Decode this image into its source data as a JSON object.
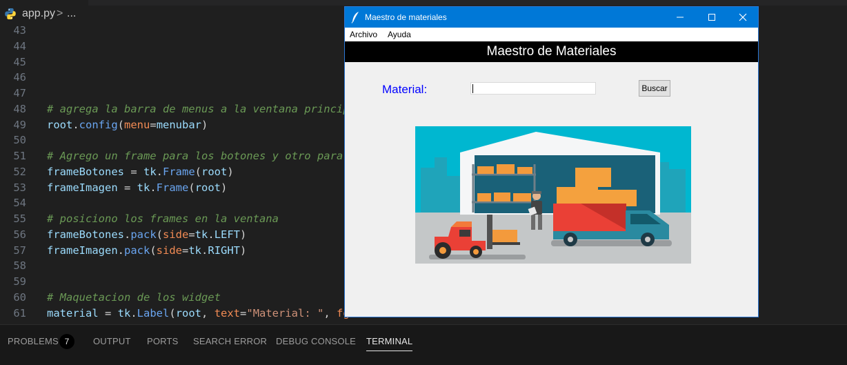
{
  "editor": {
    "breadcrumb": {
      "file": "app.py",
      "separator": ">",
      "more": "..."
    },
    "lines": [
      {
        "n": "43",
        "tokens": []
      },
      {
        "n": "44",
        "tokens": []
      },
      {
        "n": "45",
        "tokens": []
      },
      {
        "n": "46",
        "tokens": []
      },
      {
        "n": "47",
        "tokens": []
      },
      {
        "n": "48",
        "tokens": [
          {
            "c": "cm",
            "t": "# agrega la barra de menus a la ventana princip"
          }
        ]
      },
      {
        "n": "49",
        "tokens": [
          {
            "c": "var",
            "t": "root"
          },
          {
            "c": "w",
            "t": "."
          },
          {
            "c": "fn",
            "t": "config"
          },
          {
            "c": "w",
            "t": "("
          },
          {
            "c": "kw",
            "t": "menu"
          },
          {
            "c": "w",
            "t": "="
          },
          {
            "c": "var",
            "t": "menubar"
          },
          {
            "c": "w",
            "t": ")"
          }
        ]
      },
      {
        "n": "50",
        "tokens": []
      },
      {
        "n": "51",
        "tokens": [
          {
            "c": "cm",
            "t": "# Agrego un frame para los botones y otro para"
          }
        ]
      },
      {
        "n": "52",
        "tokens": [
          {
            "c": "var",
            "t": "frameBotones"
          },
          {
            "c": "w",
            "t": " = "
          },
          {
            "c": "var",
            "t": "tk"
          },
          {
            "c": "w",
            "t": "."
          },
          {
            "c": "fn",
            "t": "Frame"
          },
          {
            "c": "w",
            "t": "("
          },
          {
            "c": "var",
            "t": "root"
          },
          {
            "c": "w",
            "t": ")"
          }
        ]
      },
      {
        "n": "53",
        "tokens": [
          {
            "c": "var",
            "t": "frameImagen"
          },
          {
            "c": "w",
            "t": " = "
          },
          {
            "c": "var",
            "t": "tk"
          },
          {
            "c": "w",
            "t": "."
          },
          {
            "c": "fn",
            "t": "Frame"
          },
          {
            "c": "w",
            "t": "("
          },
          {
            "c": "var",
            "t": "root"
          },
          {
            "c": "w",
            "t": ")"
          }
        ]
      },
      {
        "n": "54",
        "tokens": []
      },
      {
        "n": "55",
        "tokens": [
          {
            "c": "cm",
            "t": "# posiciono los frames en la ventana"
          }
        ]
      },
      {
        "n": "56",
        "tokens": [
          {
            "c": "var",
            "t": "frameBotones"
          },
          {
            "c": "w",
            "t": "."
          },
          {
            "c": "fn",
            "t": "pack"
          },
          {
            "c": "w",
            "t": "("
          },
          {
            "c": "kw",
            "t": "side"
          },
          {
            "c": "w",
            "t": "="
          },
          {
            "c": "var",
            "t": "tk"
          },
          {
            "c": "w",
            "t": "."
          },
          {
            "c": "var",
            "t": "LEFT"
          },
          {
            "c": "w",
            "t": ")"
          }
        ]
      },
      {
        "n": "57",
        "tokens": [
          {
            "c": "var",
            "t": "frameImagen"
          },
          {
            "c": "w",
            "t": "."
          },
          {
            "c": "fn",
            "t": "pack"
          },
          {
            "c": "w",
            "t": "("
          },
          {
            "c": "kw",
            "t": "side"
          },
          {
            "c": "w",
            "t": "="
          },
          {
            "c": "var",
            "t": "tk"
          },
          {
            "c": "w",
            "t": "."
          },
          {
            "c": "var",
            "t": "RIGHT"
          },
          {
            "c": "w",
            "t": ")"
          }
        ]
      },
      {
        "n": "58",
        "tokens": []
      },
      {
        "n": "59",
        "tokens": []
      },
      {
        "n": "60",
        "tokens": [
          {
            "c": "cm",
            "t": "# Maquetacion de los widget"
          }
        ]
      },
      {
        "n": "61",
        "tokens": [
          {
            "c": "var",
            "t": "material"
          },
          {
            "c": "w",
            "t": " = "
          },
          {
            "c": "var",
            "t": "tk"
          },
          {
            "c": "w",
            "t": "."
          },
          {
            "c": "fn",
            "t": "Label"
          },
          {
            "c": "w",
            "t": "("
          },
          {
            "c": "var",
            "t": "root"
          },
          {
            "c": "w",
            "t": ", "
          },
          {
            "c": "kw",
            "t": "text"
          },
          {
            "c": "w",
            "t": "="
          },
          {
            "c": "str",
            "t": "\"Material: \""
          },
          {
            "c": "w",
            "t": ", "
          },
          {
            "c": "kw",
            "t": "fg"
          }
        ]
      }
    ]
  },
  "panel": {
    "tabs": [
      {
        "label": "PROBLEMS",
        "active": false
      },
      {
        "label": "OUTPUT",
        "active": false
      },
      {
        "label": "PORTS",
        "active": false
      },
      {
        "label": "SEARCH ERROR",
        "active": false
      },
      {
        "label": "DEBUG CONSOLE",
        "active": false
      },
      {
        "label": "TERMINAL",
        "active": true
      }
    ],
    "problems_count": "7"
  },
  "window": {
    "title": "Maestro de materiales",
    "menu": {
      "archivo": "Archivo",
      "ayuda": "Ayuda"
    },
    "banner": "Maestro de Materiales",
    "material_label": "Material:",
    "material_value": "",
    "search_button": "Buscar",
    "illustration": "warehouse-illustration"
  },
  "colors": {
    "editor_bg": "#1f1f1f",
    "titlebar": "#0078d7",
    "label_blue": "#0000ff",
    "banner_bg": "#000000"
  }
}
